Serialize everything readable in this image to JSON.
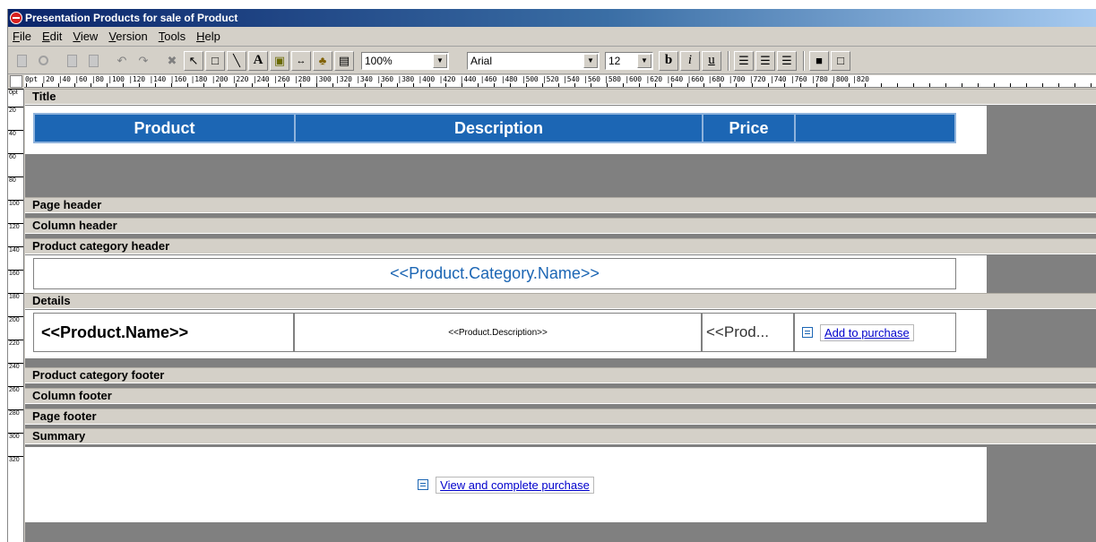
{
  "window": {
    "title": "Presentation Products for sale of Product"
  },
  "menu": [
    "File",
    "Edit",
    "View",
    "Version",
    "Tools",
    "Help"
  ],
  "toolbar": {
    "zoom": "100%",
    "font": "Arial",
    "size": "12",
    "bold": "b",
    "italic": "i",
    "underline": "u",
    "text_tool": "A",
    "icons": [
      "new-page-icon",
      "preview-icon",
      "copy-icon",
      "paste-icon",
      "undo-icon",
      "redo-icon",
      "delete-icon",
      "pointer-icon",
      "rectangle-icon",
      "line-icon",
      "text-icon",
      "image-icon",
      "link-icon",
      "chart-icon",
      "subreport-icon",
      "align-left-icon",
      "align-center-icon",
      "align-right-icon",
      "fill-color-icon",
      "border-icon"
    ]
  },
  "ruler": {
    "h_labels": "0pt |20  |40  |60  |80  |100 |120 |140 |160 |180 |200 |220 |240 |260 |280 |300 |320 |340 |360 |380 |400 |420 |440 |460 |480 |500 |520 |540 |560 |580 |600 |620 |640 |660 |680 |700 |720 |740 |760 |780 |800 |820",
    "v_labels": [
      "0pt",
      "20",
      "40",
      "60",
      "80",
      "100",
      "120",
      "140",
      "160",
      "180",
      "200",
      "220",
      "240",
      "260",
      "280",
      "300",
      "320"
    ]
  },
  "bands": {
    "title": "Title",
    "page_header": "Page header",
    "column_header": "Column header",
    "category_header": "Product category header",
    "details": "Details",
    "category_footer": "Product category footer",
    "column_footer": "Column footer",
    "page_footer": "Page footer",
    "summary": "Summary"
  },
  "title_table": {
    "product": "Product",
    "description": "Description",
    "price": "Price",
    "extra": ""
  },
  "category": {
    "field": "<<Product.Category.Name>>"
  },
  "details": {
    "name": "<<Product.Name>>",
    "description": "<<Product.Description>>",
    "price": "<<Prod...",
    "add_link": "Add to purchase"
  },
  "summary": {
    "link": "View and complete purchase"
  },
  "colors": {
    "header_blue": "#1c66b4",
    "link_blue": "#0000cc",
    "band_gray": "#d4d0c8"
  }
}
